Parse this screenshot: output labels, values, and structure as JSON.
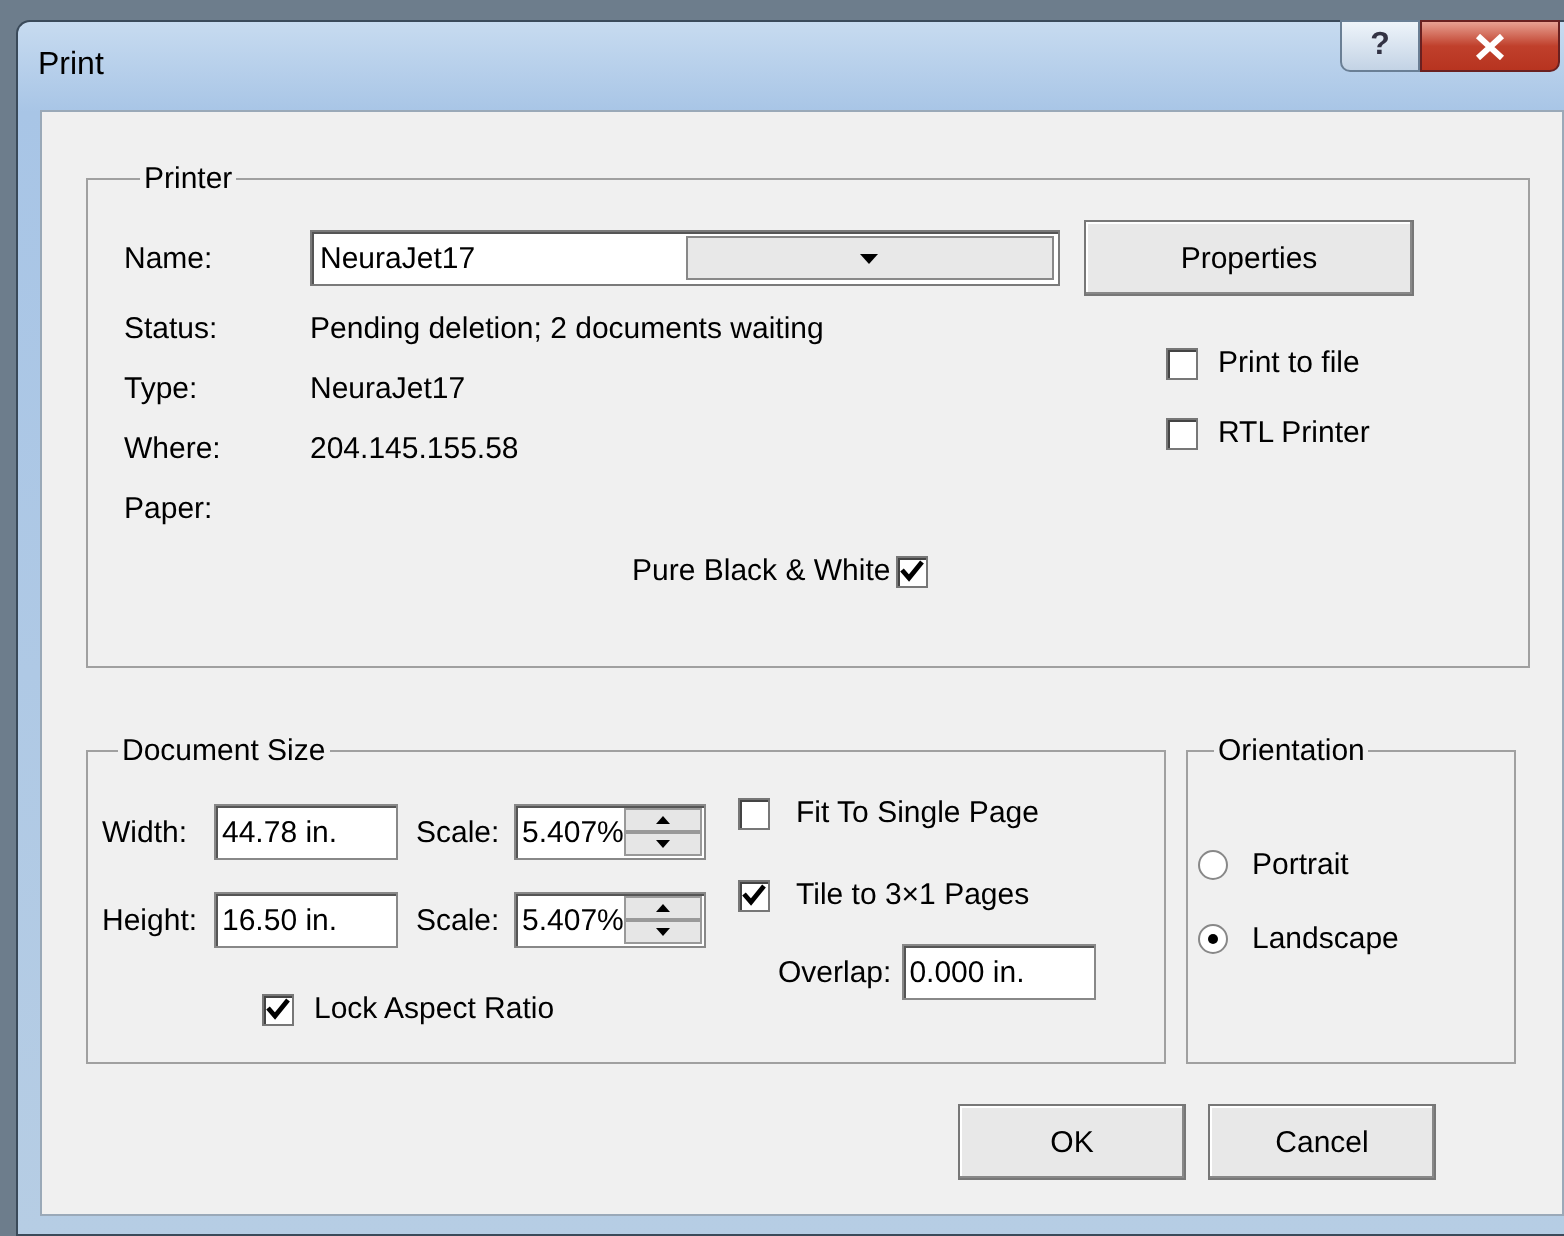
{
  "window": {
    "title": "Print",
    "help_button": "?"
  },
  "printer": {
    "title": "Printer",
    "name_label": "Name:",
    "name_value": "NeuraJet17",
    "properties_button": "Properties",
    "info": [
      {
        "label": "Status:",
        "value": "Pending deletion; 2 documents waiting"
      },
      {
        "label": "Type:",
        "value": "NeuraJet17"
      },
      {
        "label": "Where:",
        "value": "204.145.155.58"
      },
      {
        "label": "Paper:"
      }
    ],
    "options": [
      {
        "label": "Print to file",
        "checked": false
      },
      {
        "label": "RTL Printer",
        "checked": false
      }
    ],
    "pure_bw": {
      "label": "Pure Black & White",
      "checked": true
    }
  },
  "document_size": {
    "title": "Document Size",
    "rows": [
      {
        "label": "Width:",
        "value": "44.78 in.",
        "scale_label": "Scale:",
        "scale_value": "5.407%"
      },
      {
        "label": "Height:",
        "value": "16.50 in.",
        "scale_label": "Scale:",
        "scale_value": "5.407%"
      }
    ],
    "fit": {
      "label": "Fit To Single Page",
      "checked": false
    },
    "tile": {
      "label": "Tile to 3×1 Pages",
      "checked": true
    },
    "overlap_label": "Overlap:",
    "overlap_value": "0.000 in.",
    "lock": {
      "label": "Lock Aspect Ratio",
      "checked": true
    }
  },
  "orientation": {
    "title": "Orientation",
    "options": [
      {
        "label": "Portrait",
        "selected": false
      },
      {
        "label": "Landscape",
        "selected": true
      }
    ]
  },
  "buttons": [
    "OK",
    "Cancel"
  ]
}
